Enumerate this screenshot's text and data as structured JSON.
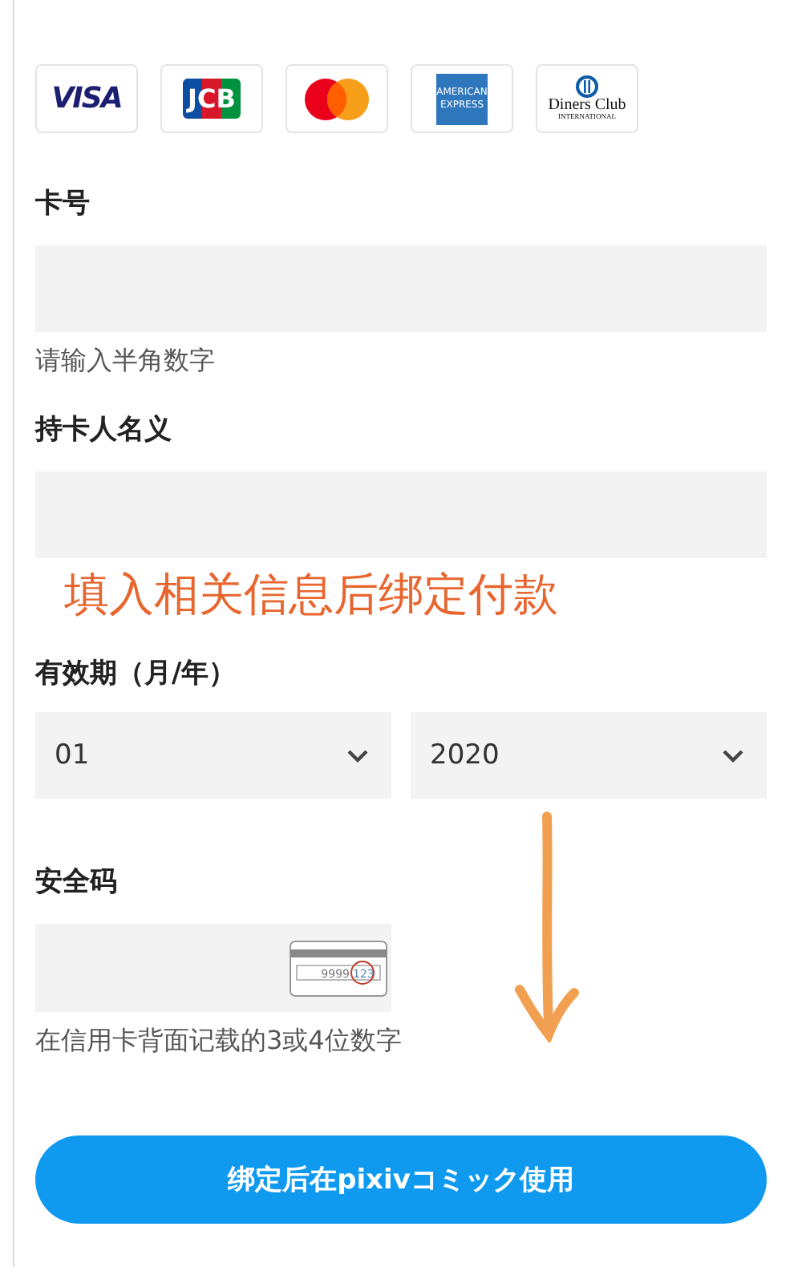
{
  "card_brands": [
    {
      "kind": "visa",
      "label": "VISA"
    },
    {
      "kind": "jcb",
      "label": "JCB"
    },
    {
      "kind": "mastercard"
    },
    {
      "kind": "amex",
      "label": "AMERICAN EXPRESS"
    },
    {
      "kind": "diners",
      "label": "Diners Club",
      "sublabel": "INTERNATIONAL"
    }
  ],
  "card_number": {
    "label": "卡号",
    "hint": "请输入半角数字"
  },
  "holder_name": {
    "label": "持卡人名义"
  },
  "annotation": "填入相关信息后绑定付款",
  "expiry": {
    "label": "有效期（月/年）",
    "month": "01",
    "year": "2020"
  },
  "security_code": {
    "label": "安全码",
    "card_number_sample": "9999",
    "code_sample": "123",
    "hint": "在信用卡背面记载的3或4位数字"
  },
  "submit_button": "绑定后在pixivコミック使用"
}
